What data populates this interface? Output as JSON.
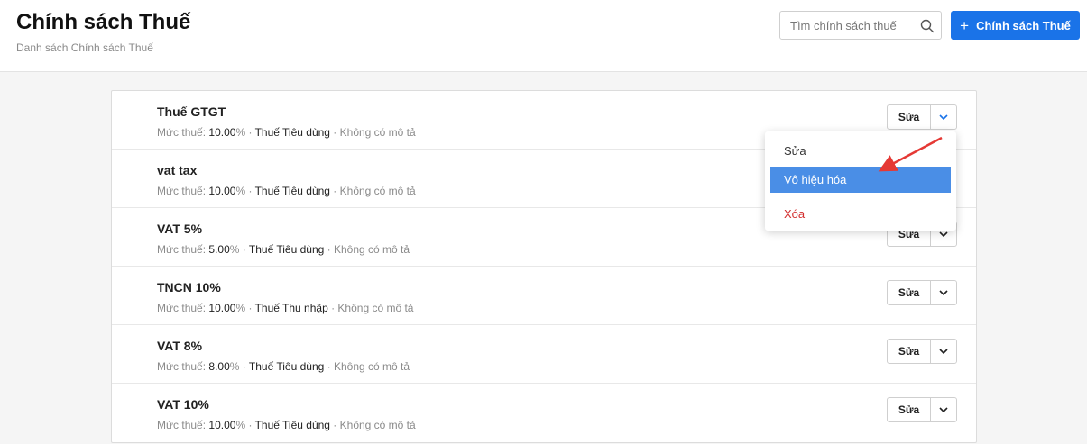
{
  "header": {
    "title": "Chính sách Thuế",
    "subtitle": "Danh sách Chính sách Thuế",
    "search_placeholder": "Tìm chính sách thuế",
    "add_button_label": "Chính sách Thuế"
  },
  "labels": {
    "rate_prefix": "Mức thuế:",
    "percent": "%",
    "separator": " · ",
    "no_description": "Không có mô tả",
    "edit": "Sửa"
  },
  "taxes": [
    {
      "name": "Thuế GTGT",
      "rate": "10.00",
      "category": "Thuế Tiêu dùng"
    },
    {
      "name": "vat tax",
      "rate": "10.00",
      "category": "Thuế Tiêu dùng"
    },
    {
      "name": "VAT 5%",
      "rate": "5.00",
      "category": "Thuế Tiêu dùng"
    },
    {
      "name": "TNCN 10%",
      "rate": "10.00",
      "category": "Thuế Thu nhập"
    },
    {
      "name": "VAT 8%",
      "rate": "8.00",
      "category": "Thuế Tiêu dùng"
    },
    {
      "name": "VAT 10%",
      "rate": "10.00",
      "category": "Thuế Tiêu dùng"
    }
  ],
  "dropdown": {
    "open_for_row": 0,
    "items": [
      {
        "label": "Sửa",
        "state": "normal"
      },
      {
        "label": "Vô hiệu hóa",
        "state": "highlighted"
      },
      {
        "label": "Xóa",
        "state": "danger"
      }
    ]
  },
  "colors": {
    "primary": "#1a73e8",
    "highlight": "#4a8ee6",
    "danger": "#d32f2f",
    "annotation_arrow": "#e53935"
  },
  "icons": {
    "search": "search-icon",
    "add": "plus-icon",
    "dropdown": "chevron-down-icon"
  }
}
